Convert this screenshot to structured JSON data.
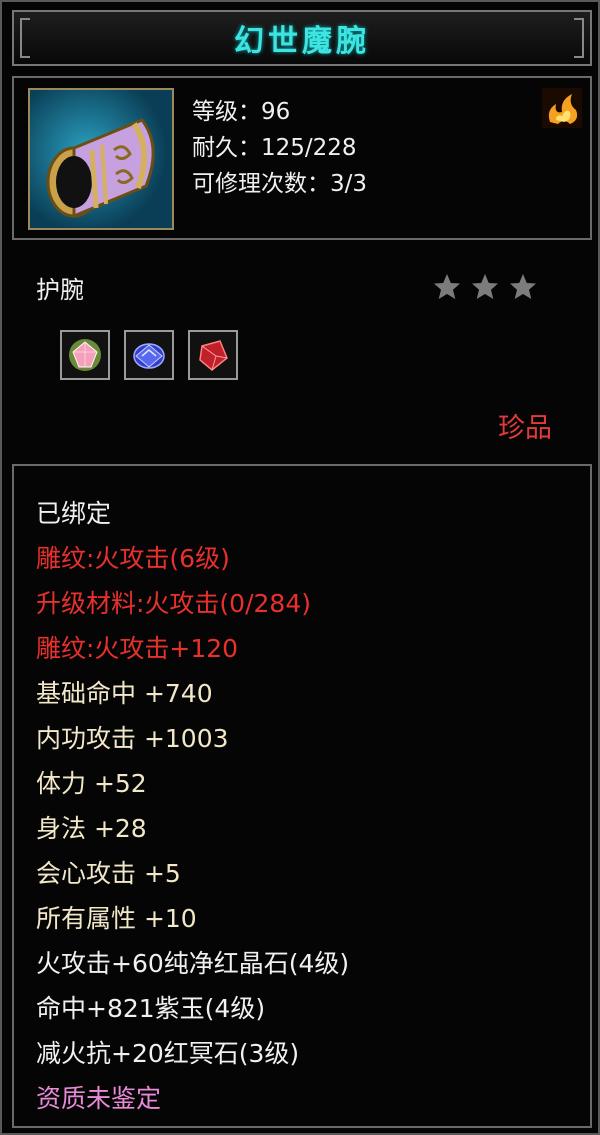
{
  "title": "幻世魔腕",
  "header": {
    "level": "等级：96",
    "durability": "耐久：125/228",
    "repairs": "可修理次数：3/3",
    "item_icon": "bracer-icon",
    "fire_icon": "fire-element-icon"
  },
  "item_type": "护腕",
  "stars": {
    "total": 3,
    "filled": 0
  },
  "gem_slots": [
    "pink-gem-icon",
    "blue-gem-icon",
    "red-gem-icon"
  ],
  "rarity": "珍品",
  "attributes": [
    {
      "text": "已绑定",
      "color": "#f0f0f0"
    },
    {
      "text": "雕纹:火攻击(6级)",
      "color": "#e8302c"
    },
    {
      "text": "升级材料:火攻击(0/284)",
      "color": "#e8302c"
    },
    {
      "text": "雕纹:火攻击+120",
      "color": "#e8302c"
    },
    {
      "text": "基础命中 +740",
      "color": "#f2e8c8"
    },
    {
      "text": "内功攻击 +1003",
      "color": "#f2e8c8"
    },
    {
      "text": "体力 +52",
      "color": "#f2e8c8"
    },
    {
      "text": "身法 +28",
      "color": "#f2e8c8"
    },
    {
      "text": "会心攻击 +5",
      "color": "#f2e8c8"
    },
    {
      "text": "所有属性 +10",
      "color": "#f2e8c8"
    },
    {
      "text": "火攻击+60纯净红晶石(4级)",
      "color": "#f0f0f0"
    },
    {
      "text": "命中+821紫玉(4级)",
      "color": "#f0f0f0"
    },
    {
      "text": "减火抗+20红冥石(3级)",
      "color": "#f0f0f0"
    },
    {
      "text": "资质未鉴定",
      "color": "#e88ad8"
    }
  ]
}
